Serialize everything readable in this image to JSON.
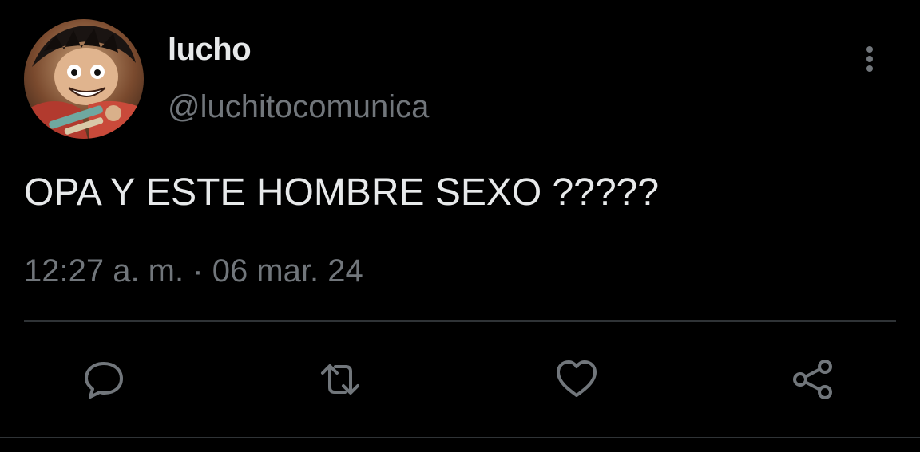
{
  "tweet": {
    "display_name": "lucho",
    "handle": "@luchitocomunica",
    "text": "OPA Y ESTE HOMBRE SEXO ?????",
    "time": "12:27 a. m.",
    "separator": "·",
    "date": "06 mar. 24"
  },
  "icons": {
    "more": "more-vertical-icon",
    "reply": "reply-icon",
    "retweet": "retweet-icon",
    "like": "heart-icon",
    "share": "share-icon"
  },
  "colors": {
    "background": "#000000",
    "primary_text": "#e7e9ea",
    "secondary_text": "#71767b",
    "divider": "#2f3336"
  }
}
